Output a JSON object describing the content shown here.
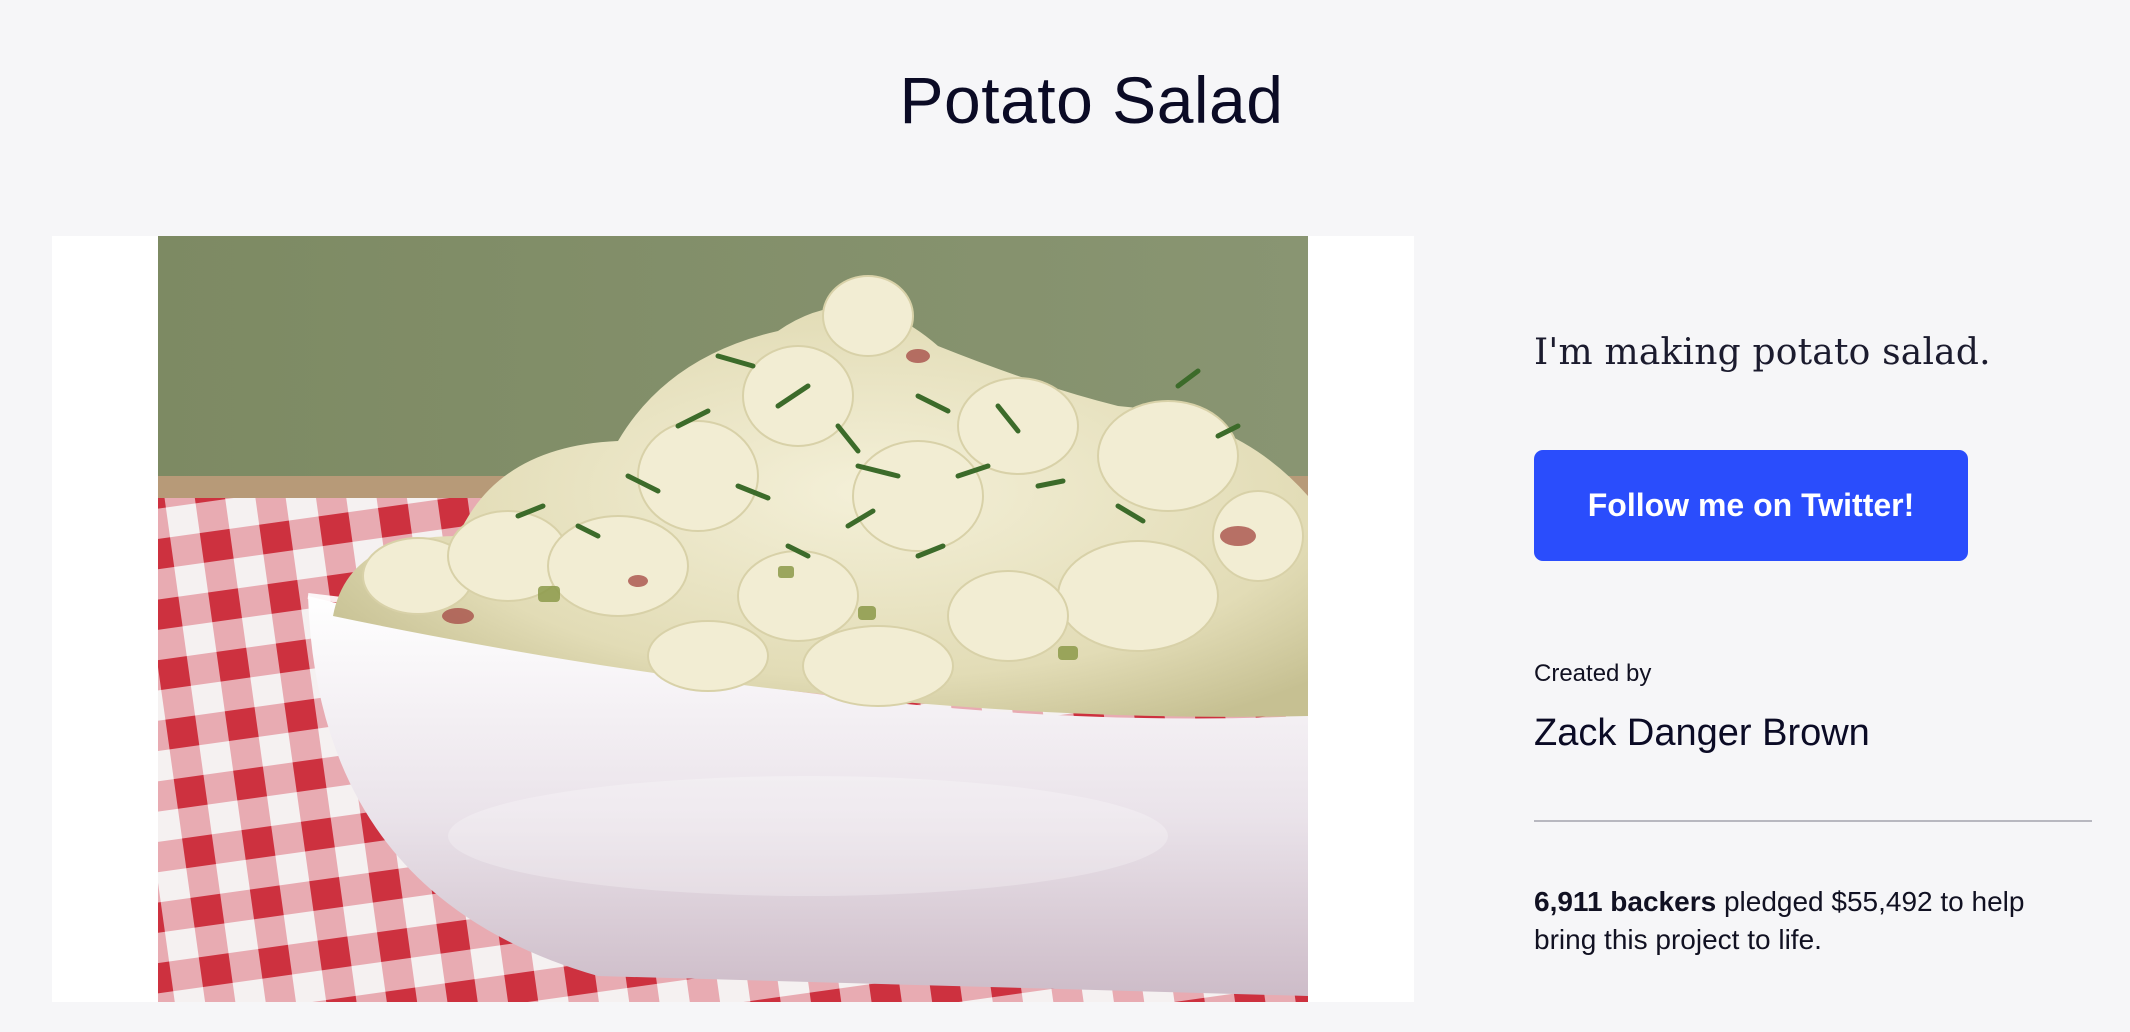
{
  "page": {
    "title": "Potato Salad"
  },
  "media": {
    "image_icon": "photo-potato-salad-bowl"
  },
  "sidebar": {
    "blurb": "I'm making potato salad.",
    "follow_button_label": "Follow me on Twitter!",
    "created_by_label": "Created by",
    "creator_name": "Zack Danger Brown",
    "backers_text": "6,911 backers",
    "pledge_text": " pledged $55,492 to help bring this project to life."
  },
  "colors": {
    "background": "#f6f6f8",
    "button": "#2a4dfc",
    "divider": "#b8b8c0"
  }
}
